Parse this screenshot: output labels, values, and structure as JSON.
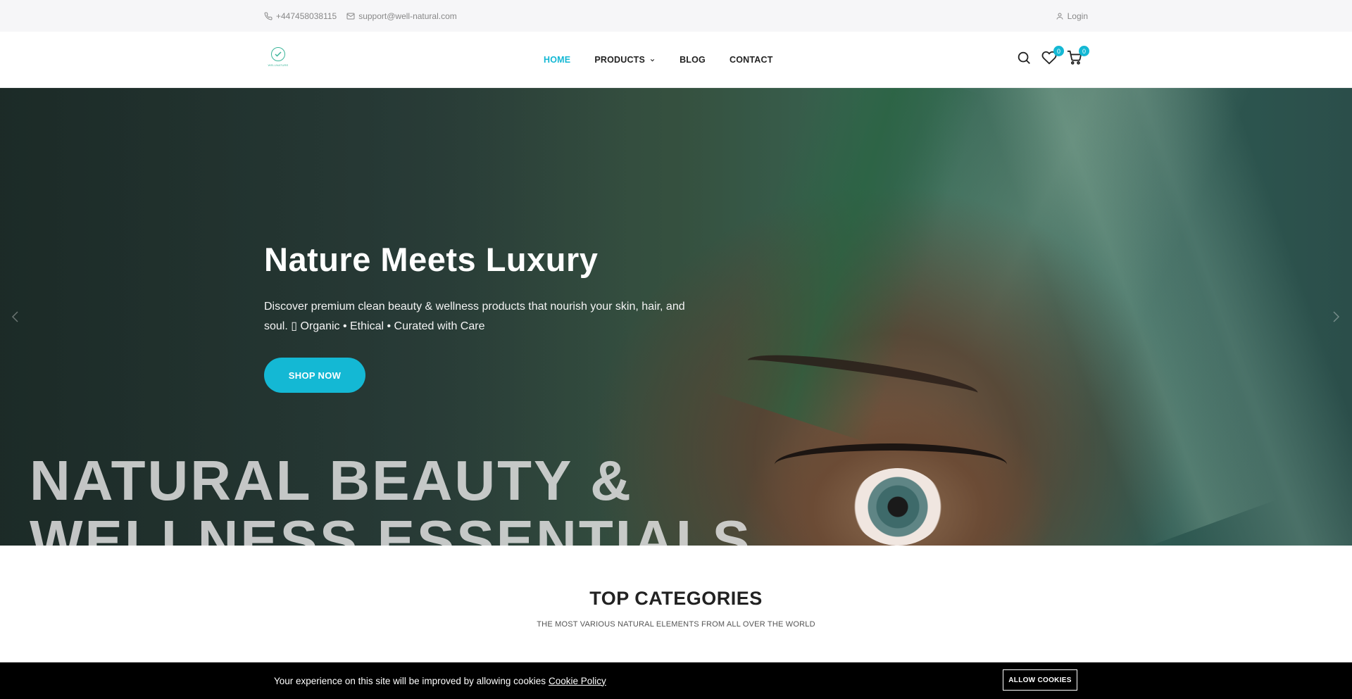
{
  "topbar": {
    "phone": "+447458038115",
    "email": "support@well-natural.com",
    "login": "Login"
  },
  "header": {
    "logo_text": "WELLNATURE",
    "nav": {
      "home": "HOME",
      "products": "PRODUCTS",
      "blog": "BLOG",
      "contact": "CONTACT"
    },
    "wishlist_count": "0",
    "cart_count": "0"
  },
  "hero": {
    "title": "Nature Meets Luxury",
    "text": "Discover premium clean beauty & wellness products that nourish your skin, hair, and soul. ▯ Organic • Ethical • Curated with Care",
    "button": "SHOP NOW",
    "big_line1": "NATURAL BEAUTY &",
    "big_line2": "WELLNESS ESSENTIALS"
  },
  "categories": {
    "title": "TOP CATEGORIES",
    "subtitle": "THE MOST VARIOUS NATURAL ELEMENTS FROM ALL OVER THE WORLD"
  },
  "cookie": {
    "message": "Your experience on this site will be improved by allowing cookies",
    "policy_link": "Cookie Policy",
    "button": "ALLOW COOKIES"
  },
  "colors": {
    "accent": "#14b8d4",
    "topbar_bg": "#f6f6f8",
    "cookie_bg": "#000000"
  }
}
